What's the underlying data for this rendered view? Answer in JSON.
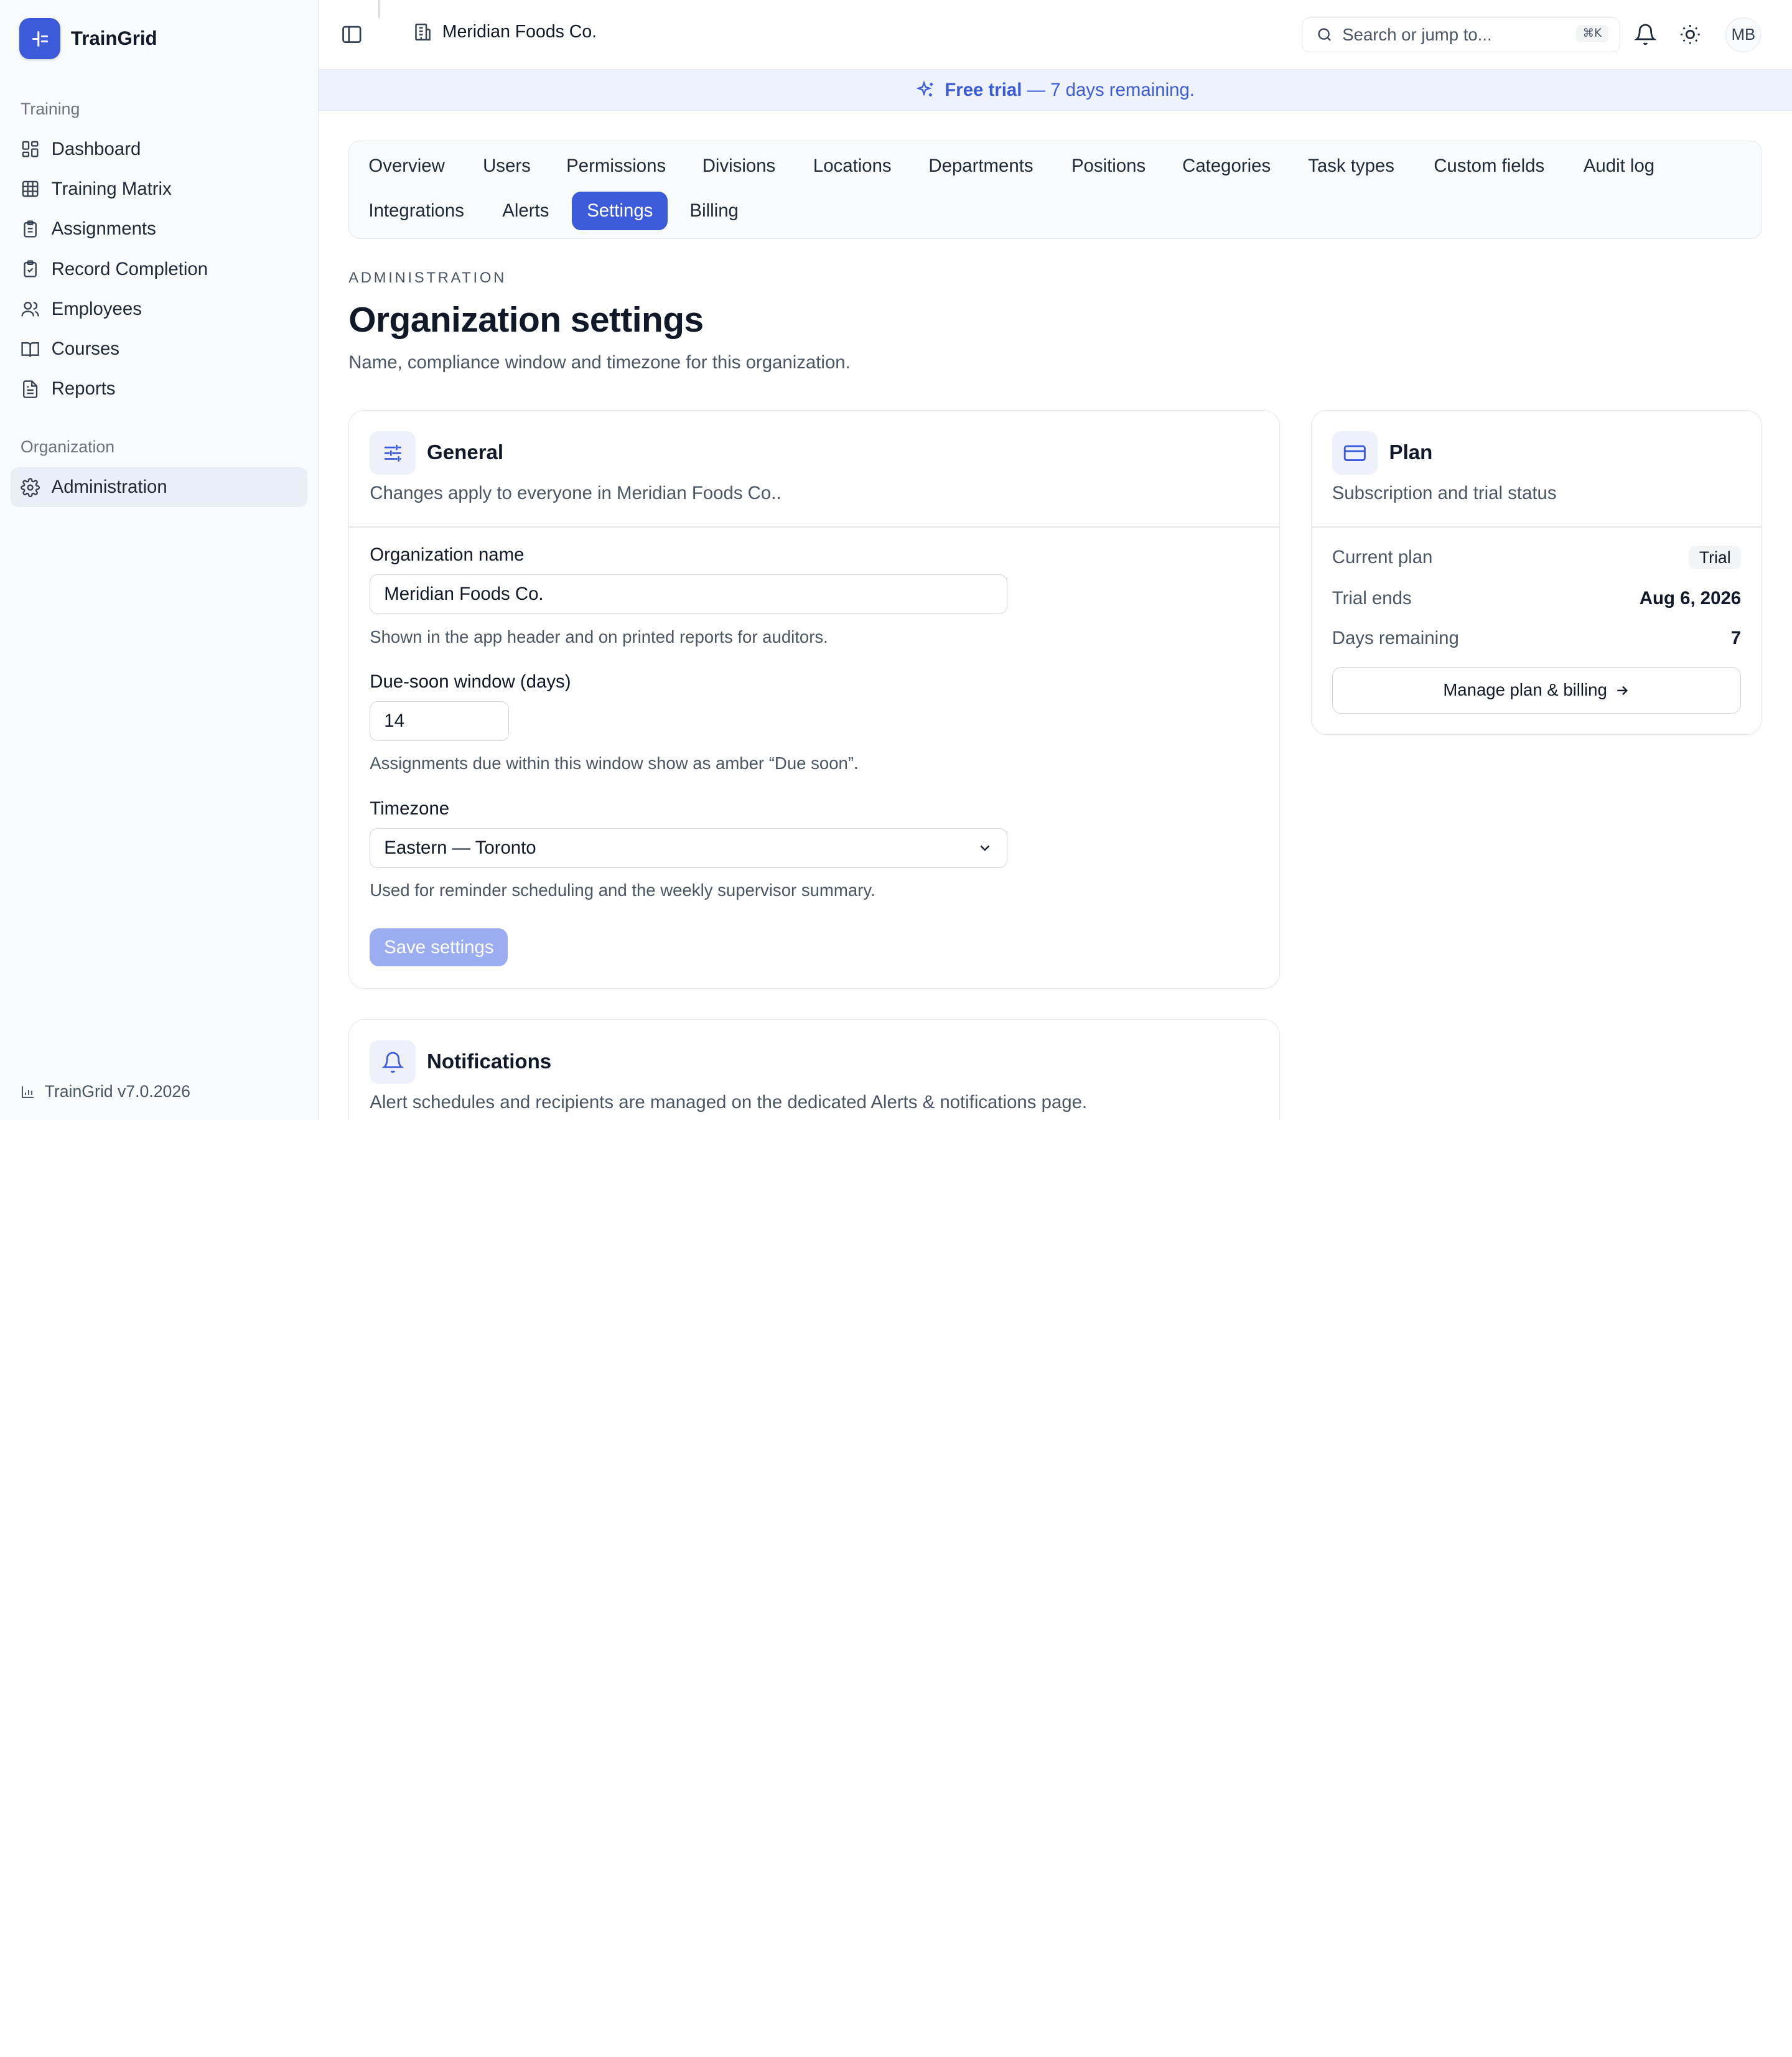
{
  "brand": {
    "name": "TrainGrid"
  },
  "sidebar": {
    "sections": [
      {
        "label": "Training"
      },
      {
        "label": "Organization"
      }
    ],
    "items": [
      {
        "label": "Dashboard"
      },
      {
        "label": "Training Matrix"
      },
      {
        "label": "Assignments"
      },
      {
        "label": "Record Completion"
      },
      {
        "label": "Employees"
      },
      {
        "label": "Courses"
      },
      {
        "label": "Reports"
      },
      {
        "label": "Administration"
      }
    ],
    "version": "TrainGrid v7.0.2026"
  },
  "topbar": {
    "org_name": "Meridian Foods Co.",
    "search_placeholder": "Search or jump to...",
    "search_shortcut": "⌘K",
    "avatar_initials": "MB"
  },
  "trial_banner": {
    "strong": "Free trial",
    "rest": " — 7 days remaining."
  },
  "tabs": [
    {
      "label": "Overview"
    },
    {
      "label": "Users"
    },
    {
      "label": "Permissions"
    },
    {
      "label": "Divisions"
    },
    {
      "label": "Locations"
    },
    {
      "label": "Departments"
    },
    {
      "label": "Positions"
    },
    {
      "label": "Categories"
    },
    {
      "label": "Task types"
    },
    {
      "label": "Custom fields"
    },
    {
      "label": "Audit log"
    },
    {
      "label": "Integrations"
    },
    {
      "label": "Alerts"
    },
    {
      "label": "Settings"
    },
    {
      "label": "Billing"
    }
  ],
  "active_tab": "Settings",
  "page": {
    "eyebrow": "ADMINISTRATION",
    "title": "Organization settings",
    "subtitle": "Name, compliance window and timezone for this organization."
  },
  "general": {
    "title": "General",
    "description": "Changes apply to everyone in Meridian Foods Co..",
    "org_name_label": "Organization name",
    "org_name_value": "Meridian Foods Co.",
    "org_name_help": "Shown in the app header and on printed reports for auditors.",
    "due_soon_label": "Due-soon window (days)",
    "due_soon_value": "14",
    "due_soon_help": "Assignments due within this window show as amber “Due soon”.",
    "timezone_label": "Timezone",
    "timezone_value": "Eastern — Toronto",
    "timezone_help": "Used for reminder scheduling and the weekly supervisor summary.",
    "save_label": "Save settings"
  },
  "notifications": {
    "title": "Notifications",
    "description": "Alert schedules and recipients are managed on the dedicated Alerts & notifications page."
  },
  "plan": {
    "title": "Plan",
    "description": "Subscription and trial status",
    "current_plan_label": "Current plan",
    "current_plan_value": "Trial",
    "trial_ends_label": "Trial ends",
    "trial_ends_value": "Aug 6, 2026",
    "days_remaining_label": "Days remaining",
    "days_remaining_value": "7",
    "manage_label": "Manage plan & billing"
  },
  "colors": {
    "accent": "#3b5bdb",
    "banner_bg": "#eef2fb",
    "sidebar_bg": "#f9fafb"
  }
}
